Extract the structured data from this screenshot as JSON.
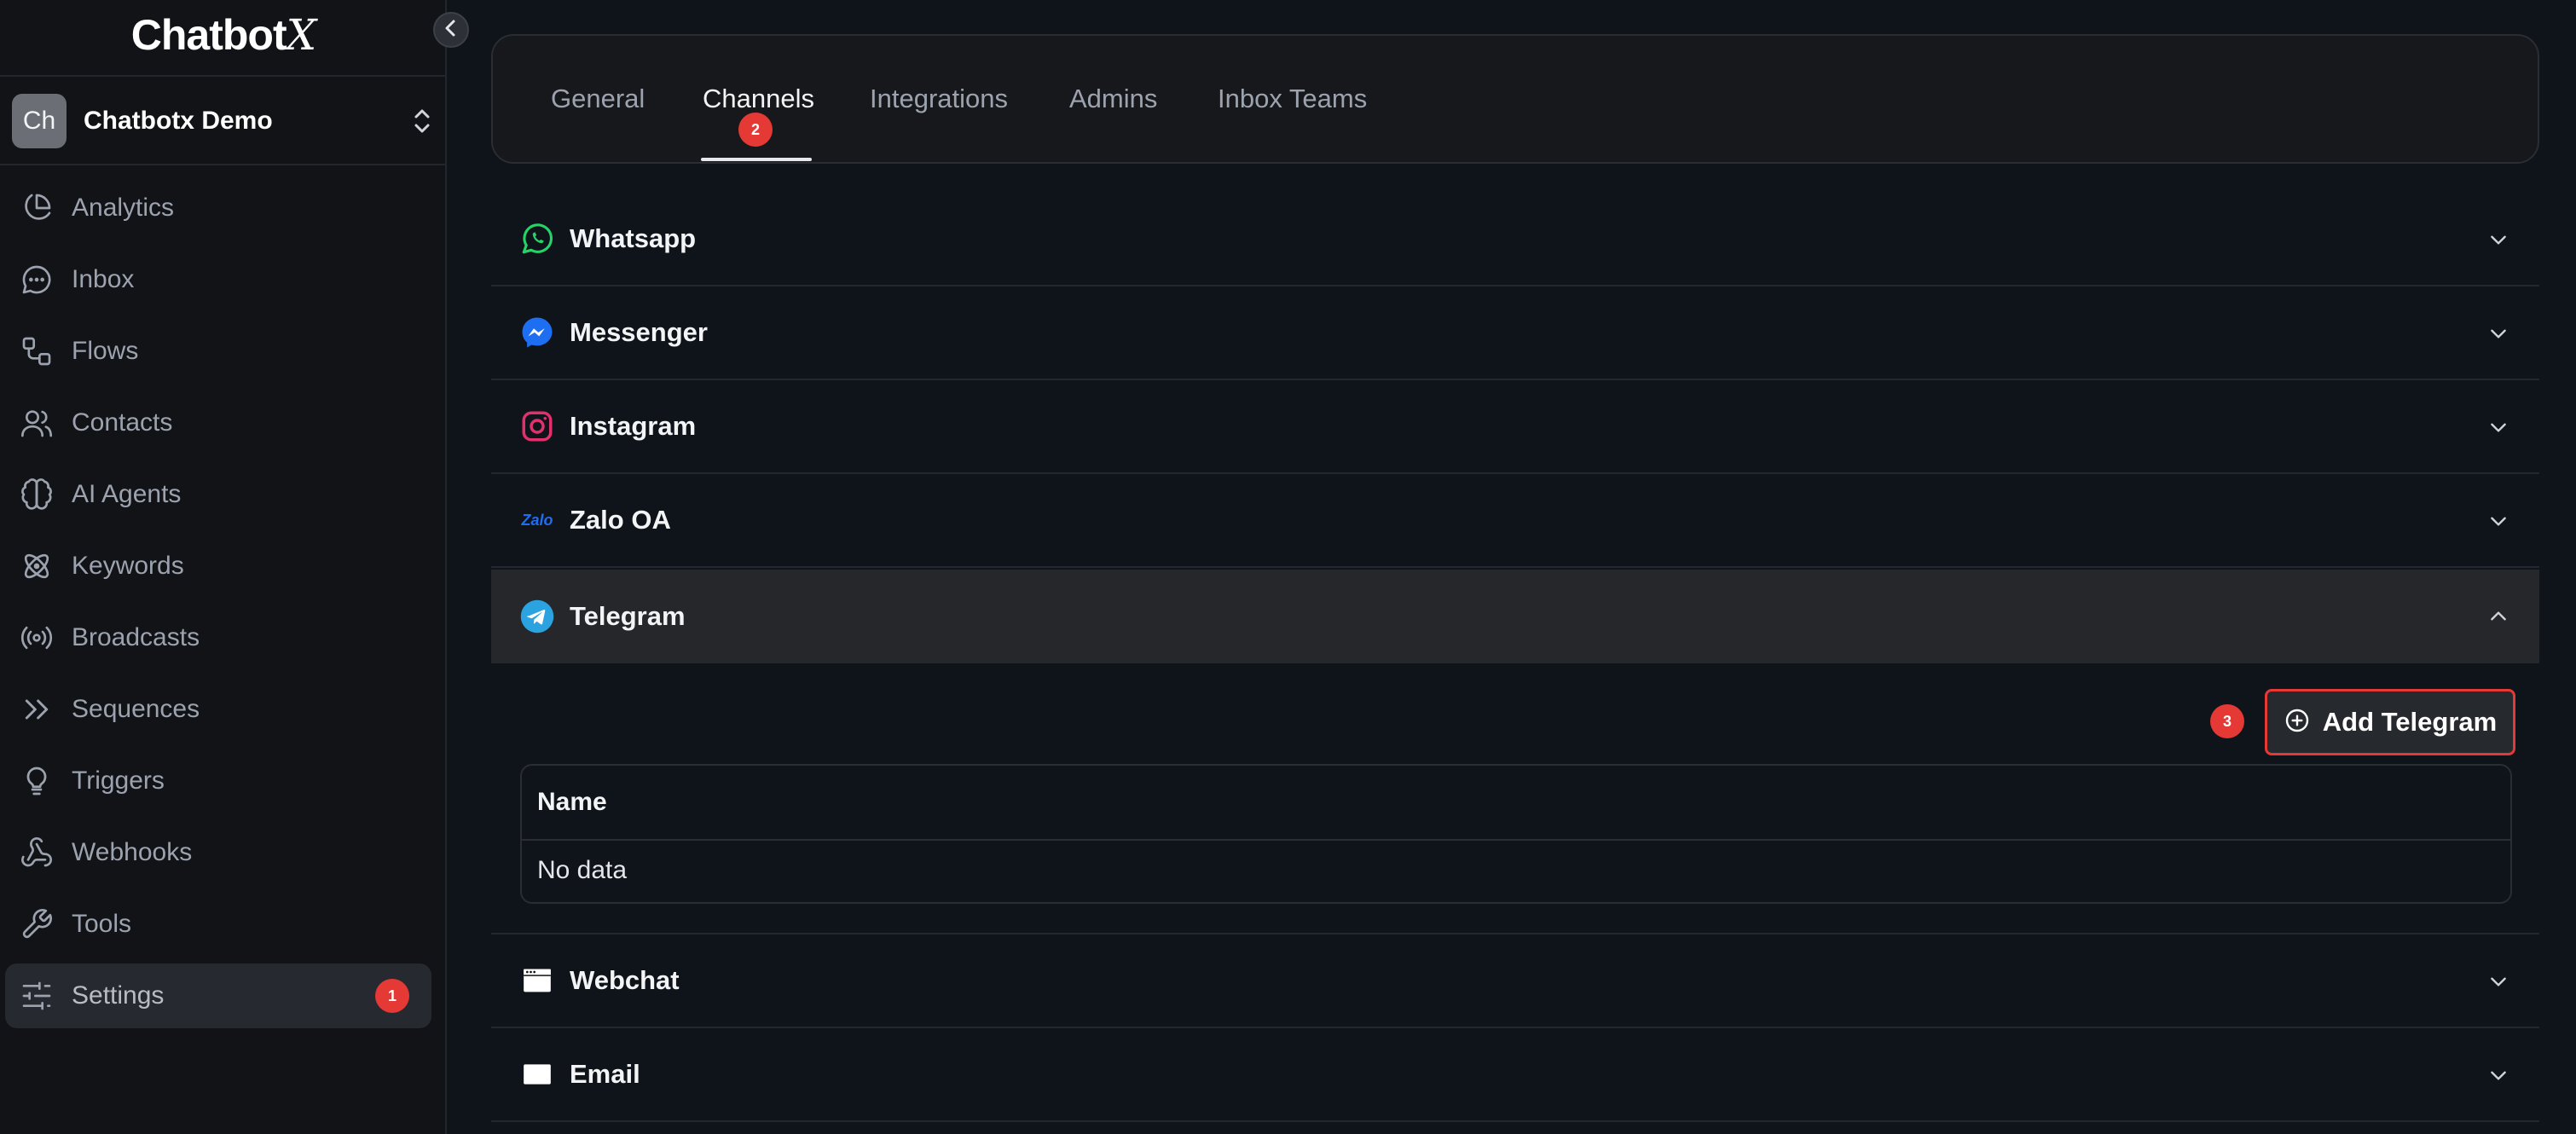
{
  "app": {
    "logo_text": "Chatbot",
    "logo_x": "X"
  },
  "workspace": {
    "avatar": "Ch",
    "name": "Chatbotx Demo"
  },
  "sidebar": {
    "items": [
      {
        "label": "Analytics",
        "icon": "pie-chart-icon"
      },
      {
        "label": "Inbox",
        "icon": "chat-bubble-icon"
      },
      {
        "label": "Flows",
        "icon": "flow-icon"
      },
      {
        "label": "Contacts",
        "icon": "users-icon"
      },
      {
        "label": "AI Agents",
        "icon": "brain-icon"
      },
      {
        "label": "Keywords",
        "icon": "atom-icon"
      },
      {
        "label": "Broadcasts",
        "icon": "broadcast-icon"
      },
      {
        "label": "Sequences",
        "icon": "chevrons-right-icon"
      },
      {
        "label": "Triggers",
        "icon": "lightbulb-icon"
      },
      {
        "label": "Webhooks",
        "icon": "webhook-icon"
      },
      {
        "label": "Tools",
        "icon": "wrench-icon"
      },
      {
        "label": "Settings",
        "icon": "sliders-icon",
        "active": true,
        "badge": "1"
      }
    ]
  },
  "tabs": [
    {
      "label": "General"
    },
    {
      "label": "Channels",
      "active": true,
      "badge": "2"
    },
    {
      "label": "Integrations"
    },
    {
      "label": "Admins"
    },
    {
      "label": "Inbox Teams"
    }
  ],
  "channels": [
    {
      "label": "Whatsapp",
      "icon": "whatsapp-icon"
    },
    {
      "label": "Messenger",
      "icon": "messenger-icon"
    },
    {
      "label": "Instagram",
      "icon": "instagram-icon"
    },
    {
      "label": "Zalo OA",
      "icon": "zalo-icon",
      "icon_text": "Zalo"
    },
    {
      "label": "Telegram",
      "icon": "telegram-icon",
      "expanded": true
    },
    {
      "label": "Webchat",
      "icon": "browser-window-icon"
    },
    {
      "label": "Email",
      "icon": "email-icon"
    }
  ],
  "telegram_panel": {
    "add_button": "Add Telegram",
    "step_badge": "3",
    "table": {
      "header": "Name",
      "empty": "No data"
    }
  },
  "colors": {
    "badge": "#e53935",
    "whatsapp": "#25d366",
    "messenger": "#1e6ef2",
    "instagram": "#e1306c",
    "telegram": "#2aa3e0"
  }
}
